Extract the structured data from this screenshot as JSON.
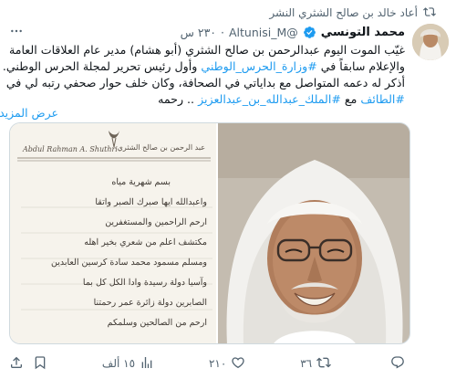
{
  "retweet": {
    "text": "أعاد خالد بن صالح الشثري النشر"
  },
  "tweet": {
    "display_name": "محمد التونسي",
    "handle": "@Altunisi_M",
    "dot": "·",
    "time": "٢٣٠ س",
    "line1": "غيّب الموت اليوم عبدالرحمن بن صالح الشثري (أبو هشام) مدير عام العلاقات العامة",
    "line2_a": "والإعلام سابقاً في ",
    "line2_link": "#وزارة_الحرس_الوطني",
    "line2_b": " وأول رئيس تحرير لمجلة الحرس الوطني.",
    "line3": "أذكر له دعمه المتواصل مع بداياتي في الصحافة، وكان خلف حوار صحفي رتبه لي في",
    "line4_link1": "#الطائف",
    "line4_a": " مع ",
    "line4_link2": "#الملك_عبدالله_بن_عبدالعزيز",
    "line4_b": " .. رحمه",
    "show_more": "عرض المزيد"
  },
  "media": {
    "left": {
      "header_latin": "Abdul Rahman A. Shuthri",
      "header_arabic": "عبد الرحمن بن صالح الشثري",
      "handwriting": [
        "بسم شهرية مياه",
        "واعبدالله ايها صبرك الصبر واتقا",
        "ارحم الراحمين والمستغفرين",
        "مكتشف اعلم من شعري بخير اهله",
        "ومسلم مسمود محمد سادة كرسين العابدين",
        "وآسيا دولة رسيدة وادا الكل كل بما",
        "الصابرين دولة زائرة عمر رحمتنا",
        "ارحم من الصالحين وسلمكم"
      ]
    }
  },
  "actions": {
    "reply": "",
    "retweet": "٣٦",
    "like": "٢١٠",
    "views": "١٥ ألف"
  },
  "colors": {
    "accent": "#1d9bf0",
    "muted": "#536471",
    "verified": "#1d9bf0"
  },
  "icons": [
    "retweet-icon",
    "verified-badge-icon",
    "more-icon",
    "reply-icon",
    "retweet-icon",
    "like-icon",
    "views-icon",
    "bookmark-icon",
    "share-icon"
  ]
}
